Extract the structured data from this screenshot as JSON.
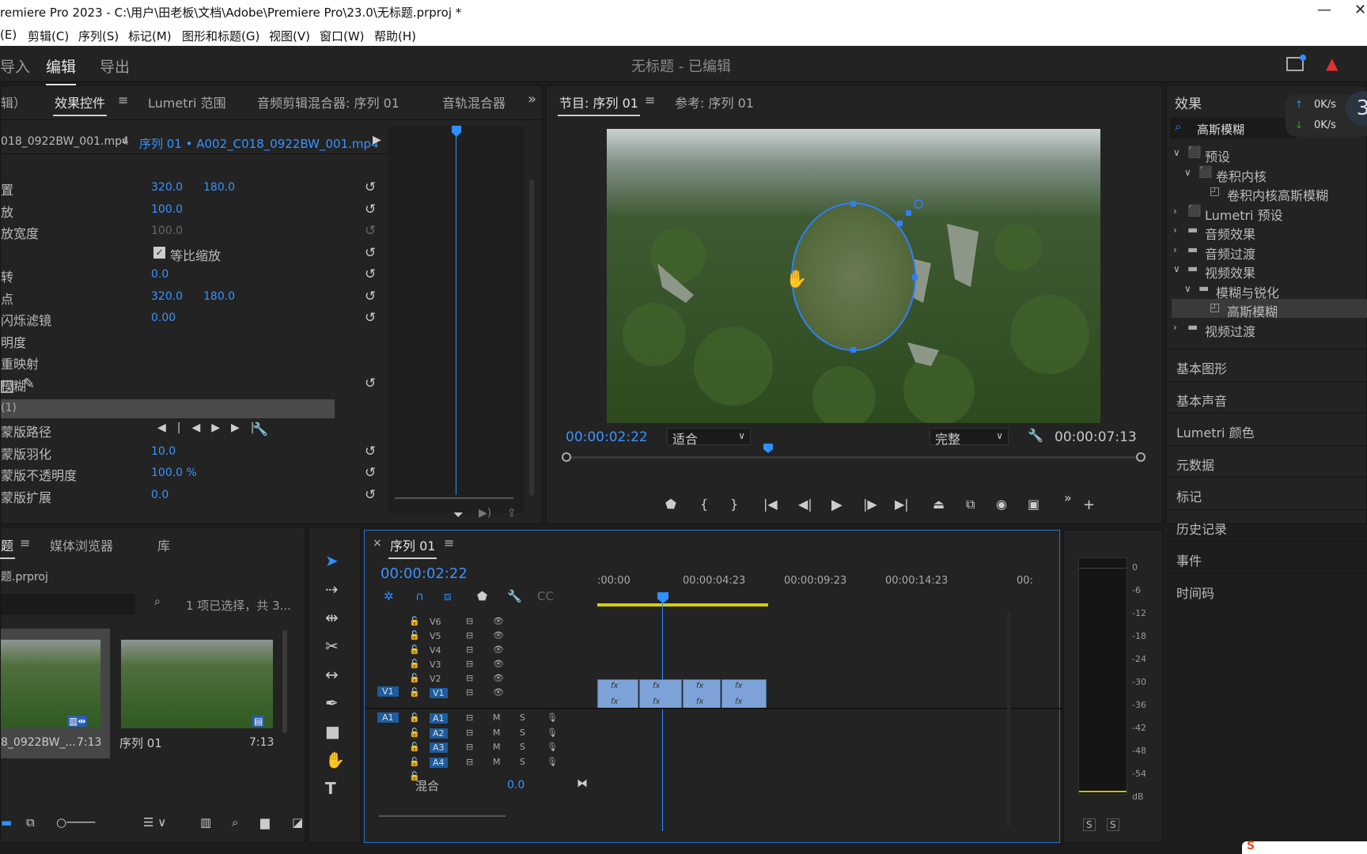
{
  "title_bar": {
    "title": "remiere Pro 2023 - C:\\用户\\田老板\\文档\\Adobe\\Premiere Pro\\23.0\\无标题.prproj *",
    "minimize": "—",
    "close": "✕"
  },
  "menu": [
    "(E)",
    "剪辑(C)",
    "序列(S)",
    "标记(M)",
    "图形和标题(G)",
    "视图(V)",
    "窗口(W)",
    "帮助(H)"
  ],
  "workspace": {
    "tabs": [
      "导入",
      "编辑",
      "导出"
    ],
    "active": "编辑",
    "doc_title": "无标题 - 已编辑"
  },
  "effect_controls": {
    "tabs": [
      "辑）",
      "效果控件",
      "Lumetri 范围",
      "音频剪辑混合器: 序列 01",
      "音轨混合器"
    ],
    "more": "»",
    "source_clip": "018_0922BW_001.mp4",
    "sequence_clip": "序列 01 • A002_C018_0922BW_001.mp4",
    "rows": [
      {
        "label": "置",
        "v1": "320.0",
        "v2": "180.0"
      },
      {
        "label": "放",
        "v1": "100.0",
        "v2": ""
      },
      {
        "label": "放宽度",
        "v1": "100.0",
        "v2": ""
      },
      {
        "label": "",
        "v1": "",
        "v2": "",
        "check": "等比缩放"
      },
      {
        "label": "转",
        "v1": "0.0",
        "v2": ""
      },
      {
        "label": "点",
        "v1": "320.0",
        "v2": "180.0"
      },
      {
        "label": "闪烁滤镜",
        "v1": "0.00",
        "v2": ""
      },
      {
        "label": "明度",
        "v1": "",
        "v2": ""
      },
      {
        "label": "重映射",
        "v1": "",
        "v2": ""
      },
      {
        "label": "模糊",
        "v1": "",
        "v2": ""
      }
    ],
    "mask_name": "(1)",
    "mask_rows": [
      {
        "label": "蒙版路径",
        "v1": ""
      },
      {
        "label": "蒙版羽化",
        "v1": "10.0"
      },
      {
        "label": "蒙版不透明度",
        "v1": "100.0 %"
      },
      {
        "label": "蒙版扩展",
        "v1": "0.0"
      }
    ]
  },
  "program_monitor": {
    "tabs": [
      "节目: 序列 01",
      "参考: 序列 01"
    ],
    "timecode": "00:00:02:22",
    "fit": "适合",
    "quality": "完整",
    "duration": "00:00:07:13"
  },
  "effects_panel": {
    "title": "效果",
    "search": "高斯模糊",
    "net_up": "0K/s",
    "net_down": "0K/s",
    "badge": "3",
    "tree": [
      "预设",
      "卷积内核",
      "卷积内核高斯模糊",
      "Lumetri 预设",
      "音频效果",
      "音频过渡",
      "视频效果",
      "模糊与锐化",
      "高斯模糊",
      "视频过渡"
    ],
    "sections": [
      "基本图形",
      "基本声音",
      "Lumetri 颜色",
      "元数据",
      "标记",
      "历史记录",
      "事件",
      "时间码"
    ]
  },
  "project": {
    "tabs": [
      "题",
      "媒体浏览器",
      "库"
    ],
    "file": "题.prproj",
    "selection": "1 项已选择，共 3...",
    "items": [
      {
        "name": "8_0922BW_...",
        "duration": "7:13"
      },
      {
        "name": "序列 01",
        "duration": "7:13"
      }
    ]
  },
  "timeline": {
    "tab": "序列 01",
    "timecode": "00:00:02:22",
    "ruler": [
      ":00:00",
      "00:00:04:23",
      "00:00:09:23",
      "00:00:14:23",
      "00:"
    ],
    "video_tracks": [
      "V6",
      "V5",
      "V4",
      "V3",
      "V2",
      "V1"
    ],
    "audio_tracks": [
      "A1",
      "A2",
      "A3",
      "A4"
    ],
    "src_v": "V1",
    "src_a": "A1",
    "mix_label": "混合",
    "mix_value": "0.0",
    "m": "M",
    "s": "S",
    "fx": "fx"
  },
  "meter": {
    "scale": [
      "0",
      "-6",
      "-12",
      "-18",
      "-24",
      "-30",
      "-36",
      "-42",
      "-48",
      "-54",
      "dB"
    ],
    "solo": [
      "S",
      "S"
    ]
  }
}
